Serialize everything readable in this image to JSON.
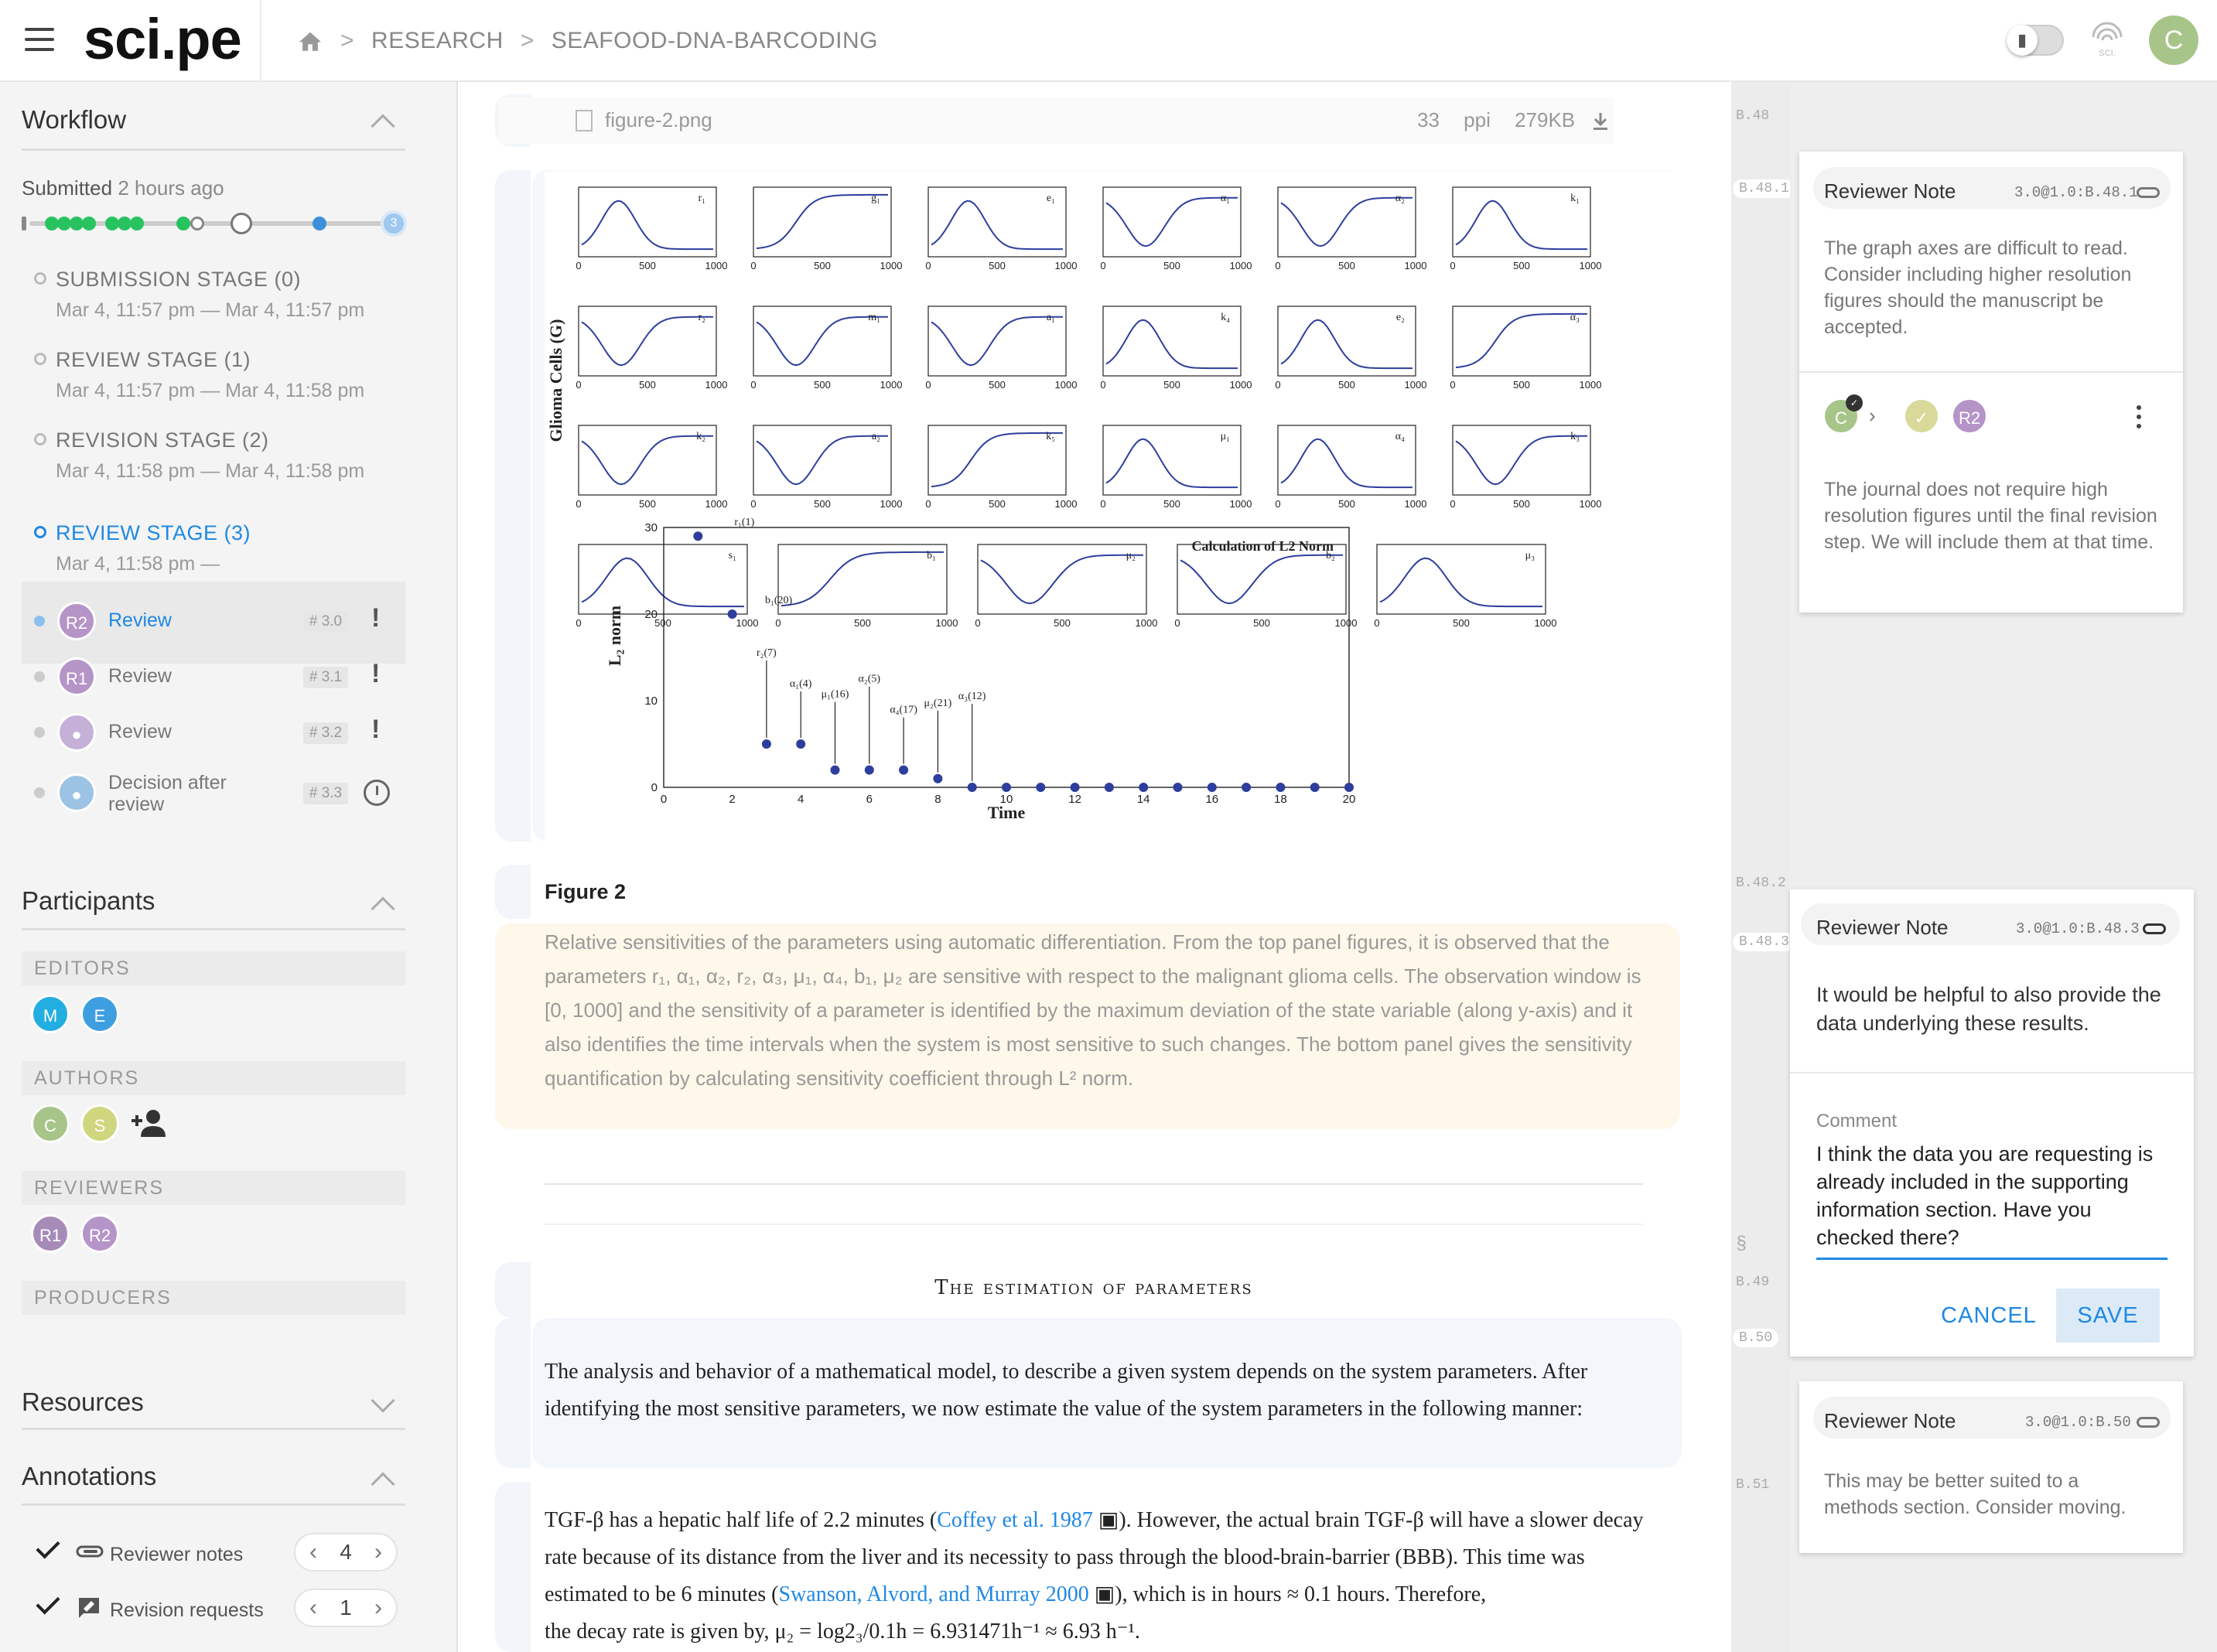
{
  "header": {
    "logo": "sci.pe",
    "breadcrumb": [
      "RESEARCH",
      "SEAFOOD-DNA-BARCODING"
    ],
    "user_initial": "C",
    "fingerprint_label": "SCI."
  },
  "workflow": {
    "title": "Workflow",
    "submitted_prefix": "Submitted",
    "submitted_time": "2 hours ago",
    "current_step": "3",
    "stages": [
      {
        "label": "SUBMISSION STAGE (0)",
        "dates": "Mar 4, 11:57 pm — Mar 4, 11:57 pm"
      },
      {
        "label": "REVIEW STAGE (1)",
        "dates": "Mar 4, 11:57 pm — Mar 4, 11:58 pm"
      },
      {
        "label": "REVISION STAGE (2)",
        "dates": "Mar 4, 11:58 pm — Mar 4, 11:58 pm"
      },
      {
        "label": "REVIEW STAGE (3)",
        "dates": "Mar 4, 11:58 pm —"
      }
    ],
    "tasks": [
      {
        "avatar": "R2",
        "label": "Review",
        "tag": "# 3.0"
      },
      {
        "avatar": "R1",
        "label": "Review",
        "tag": "# 3.1"
      },
      {
        "avatar": "",
        "label": "Review",
        "tag": "# 3.2"
      },
      {
        "avatar": "",
        "label": "Decision after review",
        "tag": "# 3.3"
      }
    ]
  },
  "participants": {
    "title": "Participants",
    "editors_label": "EDITORS",
    "editors": [
      "M",
      "E"
    ],
    "authors_label": "AUTHORS",
    "authors": [
      "C",
      "S"
    ],
    "reviewers_label": "REVIEWERS",
    "reviewers": [
      "R1",
      "R2"
    ],
    "producers_label": "PRODUCERS"
  },
  "resources": {
    "title": "Resources"
  },
  "annotations": {
    "title": "Annotations",
    "items": [
      {
        "label": "Reviewer notes",
        "count": "4"
      },
      {
        "label": "Revision requests",
        "count": "1"
      }
    ]
  },
  "document": {
    "file": {
      "name": "figure-2.png",
      "resolution": "33 ppi",
      "size": "279KB"
    },
    "figure_title": "Figure 2",
    "caption": "Relative sensitivities of the parameters using automatic differentiation. From the top panel figures, it is observed that the parameters r₁, α₁, α₂, r₂, α₃, μ₁, α₄, b₁, μ₂ are sensitive with respect to the malignant glioma cells. The observation window is [0, 1000] and the sensitivity of a parameter is identified by the maximum deviation of the state variable (along y-axis) and it also identifies the time intervals when the system is most sensitive to such changes. The bottom panel gives the sensitivity quantification by calculating sensitivity coefficient through L² norm.",
    "section_heading": "The estimation of parameters",
    "para1": "The analysis and behavior of a mathematical model, to describe a given system depends on the system parameters. After identifying the most sensitive parameters, we now estimate the value of the system parameters in the following manner:",
    "para2_a": "TGF-β has a hepatic half life of 2.2 minutes (",
    "para2_cite1": "Coffey et al. 1987",
    "para2_b": "). However, the actual brain TGF-β will have a slower decay rate because of its distance from the liver and its necessity to pass through the blood-brain-barrier (BBB). This time was estimated to be 6 minutes (",
    "para2_cite2": "Swanson, Alvord, and Murray 2000",
    "para2_c": "), which is in hours ≈ 0.1 hours. Therefore,",
    "para2_d": "the decay rate is given by, μ₂ = log2₃/0.1h = 6.931471h⁻¹ ≈ 6.93 h⁻¹.",
    "figure": {
      "ylabel": "Glioma Cells (G)",
      "norm_title": "Calculation of L2 Norm",
      "norm_xlabel": "Time",
      "norm_ylabel": "L₂ norm"
    }
  },
  "gutter": {
    "tags": [
      "B.48",
      "B.48.1",
      "B.48.2",
      "B.48.3",
      "§",
      "B.49",
      "B.50",
      "B.51"
    ]
  },
  "notes": {
    "note1": {
      "title": "Reviewer Note",
      "id": "3.0@1.0:B.48.1",
      "body": "The graph axes are difficult to read. Consider including higher resolution figures should the manuscript be accepted.",
      "avatars": [
        "C",
        "R2"
      ],
      "reply": "The journal does not require high resolution figures until the final revision step. We will include them at that time."
    },
    "note2": {
      "title": "Reviewer Note",
      "id": "3.0@1.0:B.48.3",
      "body": "It would be helpful to also provide the data underlying these results.",
      "comment_label": "Comment",
      "comment_text": "I think the data you are requesting is already included in the supporting information section. Have you checked there?",
      "cancel": "CANCEL",
      "save": "SAVE"
    },
    "note3": {
      "title": "Reviewer Note",
      "id": "3.0@1.0:B.50",
      "body": "This may be better suited to a methods section. Consider moving."
    }
  },
  "colors": {
    "accent": "#1e88e5",
    "green": "#27c35f",
    "caption_bg": "#fdf8e9"
  },
  "chart_data": [
    {
      "type": "line",
      "title": "",
      "panel_labels": [
        "r₁",
        "g₁",
        "e₁",
        "α₁",
        "α₂",
        "k₁",
        "r₂",
        "m₁",
        "a₁",
        "k₄",
        "e₂",
        "α₃",
        "k₂",
        "a₂",
        "k₅",
        "μ₁",
        "α₄",
        "k₃",
        "s₁",
        "b₁",
        "μ₂",
        "b₂",
        "μ₃"
      ],
      "xlim": [
        0,
        1000
      ]
    },
    {
      "type": "scatter",
      "title": "Calculation of L2 Norm",
      "xlabel": "Time",
      "ylabel": "L₂ norm",
      "x": [
        1,
        2,
        3,
        4,
        5,
        6,
        7,
        8,
        9,
        10,
        11,
        12,
        13,
        14,
        15,
        16,
        17,
        18,
        19,
        20
      ],
      "y": [
        29,
        20,
        5,
        5,
        2,
        2,
        2,
        1,
        0,
        0,
        0,
        0,
        0,
        0,
        0,
        0,
        0,
        0,
        0,
        0
      ],
      "point_labels": [
        "r₁(1)",
        "b₁(20)",
        "r₂(7)",
        "α₁(4)",
        "μ₁(16)",
        "α₂(5)",
        "α₄(17)",
        "μ₂(21)",
        "α₃(12)"
      ],
      "xlim": [
        0,
        20
      ],
      "ylim": [
        0,
        30
      ]
    }
  ]
}
